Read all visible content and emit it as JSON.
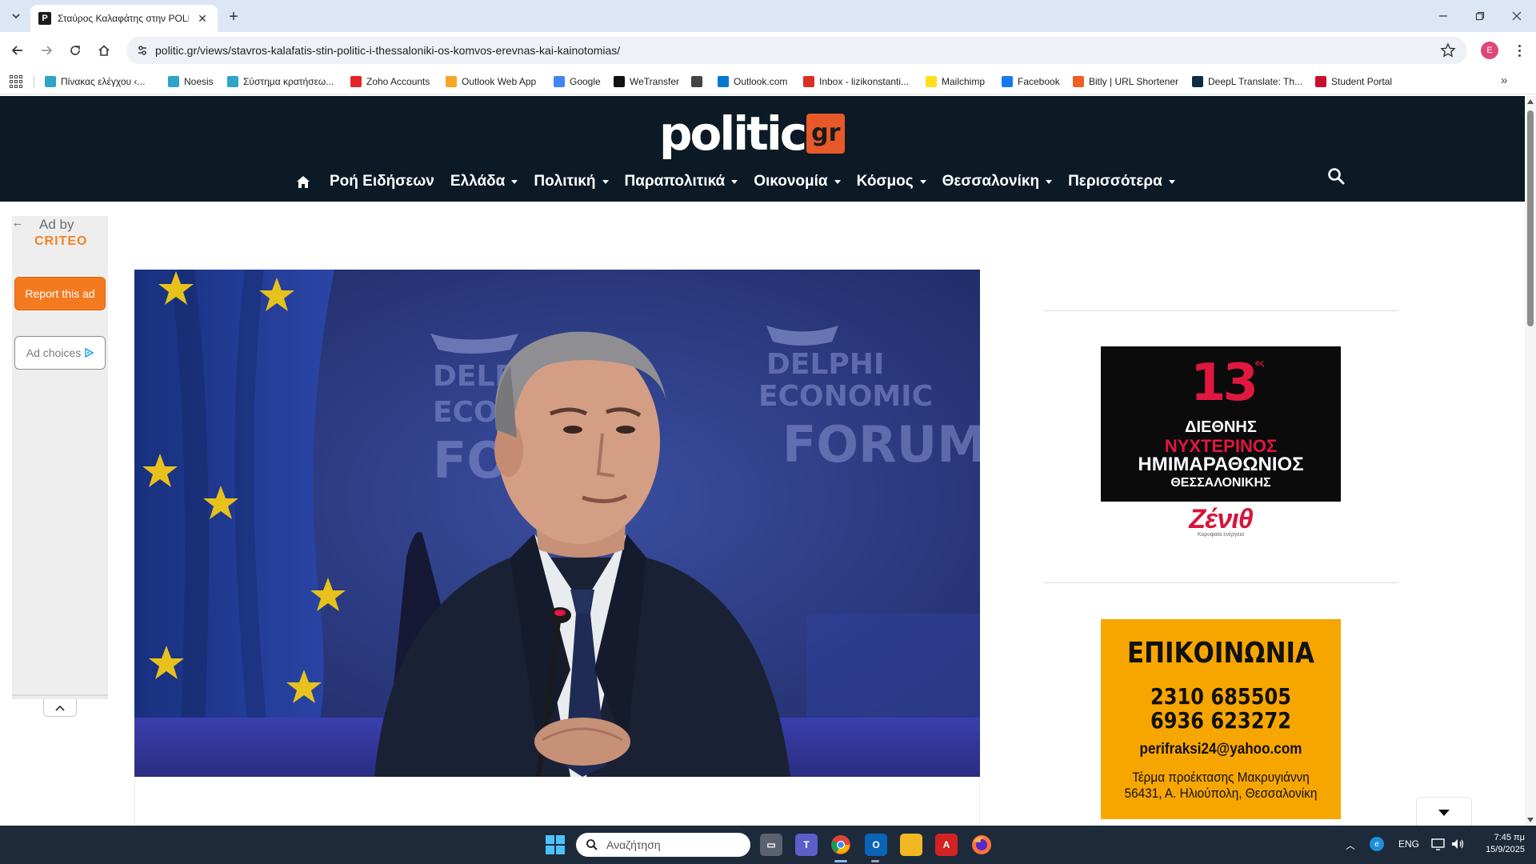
{
  "browser": {
    "tab_title": "Σταύρος Καλαφάτης στην POLITIC",
    "url": "politic.gr/views/stavros-kalafatis-stin-politic-i-thessaloniki-os-komvos-erevnas-kai-kainotomias/",
    "profile_initial": "E"
  },
  "bookmarks": [
    {
      "label": "Πίνακας ελέγχου ‹...",
      "icon": "dashboard-icon",
      "color": "#2fa3c8"
    },
    {
      "label": "Noesis",
      "icon": "noesis-icon",
      "color": "#2fa3c8"
    },
    {
      "label": "Σύστημα κρατήσεω...",
      "icon": "booking-icon",
      "color": "#2fa3c8"
    },
    {
      "label": "Zoho Accounts",
      "icon": "zoho-icon",
      "color": "#e42527"
    },
    {
      "label": "Outlook Web App",
      "icon": "outlook-icon",
      "color": "#f5a623"
    },
    {
      "label": "Google",
      "icon": "google-icon",
      "color": "#4285f4"
    },
    {
      "label": "WeTransfer",
      "icon": "wetransfer-icon",
      "color": "#111111"
    },
    {
      "label": "",
      "icon": "globe-icon",
      "color": "#444444"
    },
    {
      "label": "Outlook.com",
      "icon": "microsoft-icon",
      "color": "#0078d4"
    },
    {
      "label": "Inbox - lizikonstanti...",
      "icon": "gmail-icon",
      "color": "#d93025"
    },
    {
      "label": "Mailchimp",
      "icon": "mailchimp-icon",
      "color": "#ffe01b"
    },
    {
      "label": "Facebook",
      "icon": "facebook-icon",
      "color": "#1877f2"
    },
    {
      "label": "Bitly | URL Shortener",
      "icon": "bitly-icon",
      "color": "#ee6123"
    },
    {
      "label": "DeepL Translate: Th...",
      "icon": "deepl-icon",
      "color": "#0f2b46"
    },
    {
      "label": "Student Portal",
      "icon": "portal-icon",
      "color": "#c8102e"
    }
  ],
  "site": {
    "logo_word": "politic",
    "logo_tag": "gr",
    "nav": [
      {
        "label": "Ροή Ειδήσεων",
        "dropdown": false
      },
      {
        "label": "Ελλάδα",
        "dropdown": true
      },
      {
        "label": "Πολιτική",
        "dropdown": true
      },
      {
        "label": "Παραπολιτικά",
        "dropdown": true
      },
      {
        "label": "Οικονομία",
        "dropdown": true
      },
      {
        "label": "Κόσμος",
        "dropdown": true
      },
      {
        "label": "Θεσσαλονίκη",
        "dropdown": true
      },
      {
        "label": "Περισσότερα",
        "dropdown": true
      }
    ],
    "colors": {
      "header_bg": "#0b1a24",
      "logo_accent": "#e8592a"
    }
  },
  "ad_rail": {
    "ad_by": "Ad by",
    "brand": "CRITEO",
    "report": "Report this ad",
    "choices": "Ad choices"
  },
  "hero": {
    "backdrop_text_1": "DELPHI",
    "backdrop_text_2": "ECONOMIC",
    "backdrop_text_3": "FORUM"
  },
  "sidebar": {
    "marathon_ad": {
      "number": "13",
      "suffix": "ος",
      "line1": "ΔΙΕΘΝΗΣ",
      "line2": "ΝΥΧΤΕΡΙΝΟΣ",
      "line3": "ΗΜΙΜΑΡΑΘΩΝΙΟΣ",
      "line4": "ΘΕΣΣΑΛΟΝΙΚΗΣ",
      "sponsor": "Ζένιθ",
      "sponsor_sub": "Κορυφαία ενέργεια"
    },
    "contact_ad": {
      "title": "ΕΠΙΚΟΙΝΩΝΙΑ",
      "phone1": "2310 685505",
      "phone2": "6936 623272",
      "email": "perifraksi24@yahoo.com",
      "address1": "Τέρμα προέκτασης Μακρυγιάννη",
      "address2": "56431, Α. Ηλιούπολη, Θεσσαλονίκη"
    }
  },
  "taskbar": {
    "search_placeholder": "Αναζήτηση",
    "lang": "ENG",
    "time": "7:45 πμ",
    "date": "15/9/2025"
  }
}
